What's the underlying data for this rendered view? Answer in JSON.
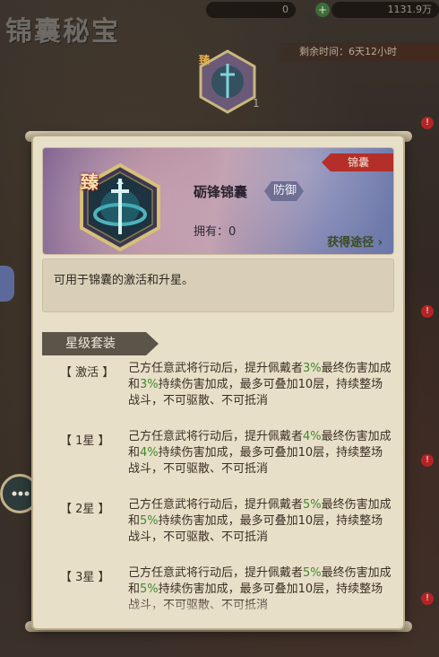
{
  "background": {
    "title": "锦囊秘宝",
    "resource_1": "0",
    "resource_2": "1131.9万",
    "remaining_time": "剩余时间：6天12小时",
    "top_item_count": "1",
    "top_item_badge": "臻"
  },
  "item": {
    "quality_badge": "臻",
    "name": "砺锋锦囊",
    "type_tag": "防御",
    "owned": "拥有：0",
    "category": "锦囊",
    "obtain_link": "获得途径"
  },
  "description": "可用于锦囊的激活和升星。",
  "star_section": {
    "title": "星级套装",
    "levels": [
      {
        "level": "【 激活 】",
        "pct_a": "3%",
        "pct_b": "3%"
      },
      {
        "level": "【 1星 】",
        "pct_a": "4%",
        "pct_b": "4%"
      },
      {
        "level": "【 2星 】",
        "pct_a": "5%",
        "pct_b": "5%"
      },
      {
        "level": "【 3星 】",
        "pct_a": "5%",
        "pct_b": "5%"
      }
    ],
    "text_part_1": "己方任意武将行动后，提升佩戴者",
    "text_part_2": "最终伤害加成和",
    "text_part_3": "持续伤害加成，最多可叠加10层，持续整场战斗，不可驱散、不可抵消"
  },
  "colors": {
    "highlight_green": "#3f8a2c",
    "ribbon_red": "#b42e2a",
    "panel_paper": "#e8dfc9"
  }
}
